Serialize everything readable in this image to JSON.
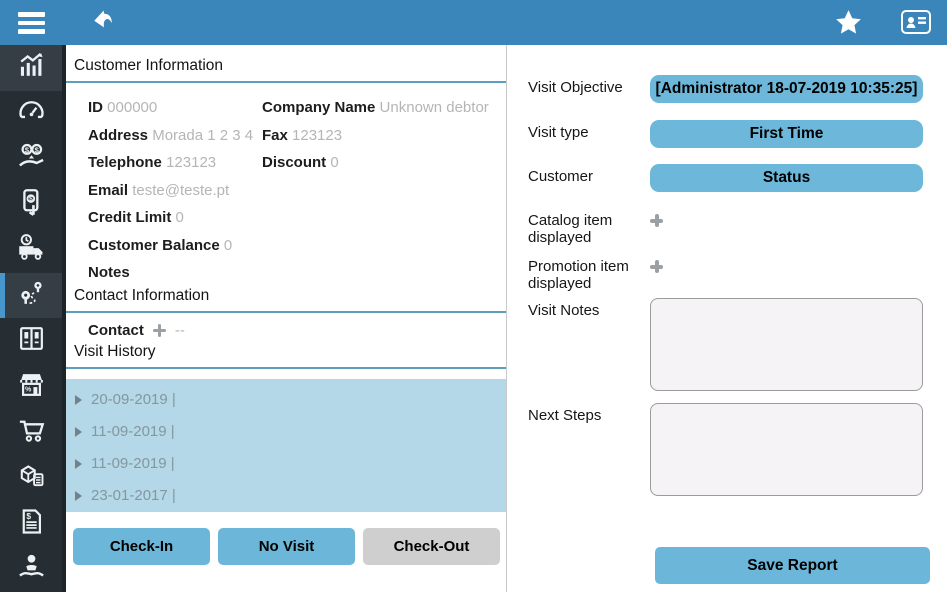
{
  "colors": {
    "topbar": "#3a86bb",
    "sidebar": "#262d33",
    "accent_line": "#5b9fba",
    "button_blue": "#6cb7d9",
    "button_gray": "#cfcfcf",
    "history_bg": "#b4d8e7",
    "active_item_bar": "#4796cc"
  },
  "topbar": {
    "icons": [
      "menu-icon",
      "back-icon",
      "star-icon",
      "contact-card-icon"
    ]
  },
  "sidebar": {
    "items": [
      {
        "icon": "bar-chart-icon",
        "active": false
      },
      {
        "icon": "gauge-icon",
        "active": false
      },
      {
        "icon": "money-hand-icon",
        "active": false
      },
      {
        "icon": "mobile-payment-icon",
        "active": false
      },
      {
        "icon": "delivery-truck-icon",
        "active": false
      },
      {
        "icon": "route-icon",
        "active": true
      },
      {
        "icon": "catalog-icon",
        "active": false
      },
      {
        "icon": "store-icon",
        "active": false
      },
      {
        "icon": "cart-icon",
        "active": false
      },
      {
        "icon": "inventory-icon",
        "active": false
      },
      {
        "icon": "invoice-icon",
        "active": false
      },
      {
        "icon": "customer-support-icon",
        "active": false
      }
    ]
  },
  "customer": {
    "section_title": "Customer Information",
    "fields": [
      {
        "label": "ID",
        "value": "000000"
      },
      {
        "label": "Company Name",
        "value": "Unknown debtor"
      },
      {
        "label": "Address",
        "value": "Morada 1 2 3 4"
      },
      {
        "label": "Fax",
        "value": "123123"
      },
      {
        "label": "Telephone",
        "value": "123123"
      },
      {
        "label": "Discount",
        "value": "0"
      },
      {
        "label": "Email",
        "value": "teste@teste.pt"
      },
      {
        "label": "Credit Limit",
        "value": "0"
      },
      {
        "label": "Customer Balance",
        "value": "0"
      },
      {
        "label": "Notes",
        "value": ""
      }
    ]
  },
  "contact": {
    "section_title": "Contact Information",
    "label": "Contact",
    "value": "--"
  },
  "visit_history": {
    "section_title": "Visit History",
    "entries": [
      "20-09-2019 |",
      "11-09-2019 |",
      "11-09-2019 |",
      "23-01-2017 |"
    ]
  },
  "actions": {
    "check_in": "Check-In",
    "no_visit": "No Visit",
    "check_out": "Check-Out"
  },
  "report": {
    "visit_objective_label": "Visit Objective",
    "visit_objective_value": "[Administrator 18-07-2019 10:35:25]",
    "visit_type_label": "Visit type",
    "visit_type_value": "First Time",
    "customer_label": "Customer",
    "customer_value": "Status",
    "catalog_item_label": "Catalog item displayed",
    "promotion_item_label": "Promotion item displayed",
    "visit_notes_label": "Visit Notes",
    "next_steps_label": "Next Steps",
    "save_button": "Save Report"
  }
}
